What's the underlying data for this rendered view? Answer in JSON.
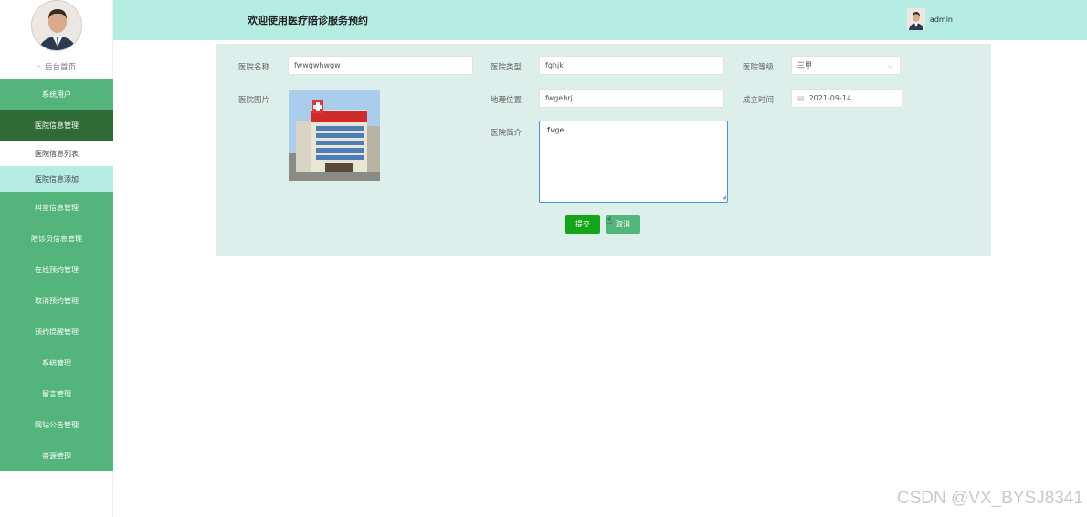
{
  "sidebar": {
    "home_label": "后台首页",
    "menu": [
      {
        "label": "系统用户",
        "active": false
      },
      {
        "label": "医院信息管理",
        "active": true
      }
    ],
    "sub_items": [
      {
        "label": "医院信息列表",
        "active": false
      },
      {
        "label": "医院信息添加",
        "active": true
      }
    ],
    "menu_after": [
      {
        "label": "科室信息管理"
      },
      {
        "label": "陪诊员信息管理"
      },
      {
        "label": "在线预约管理"
      },
      {
        "label": "取消预约管理"
      },
      {
        "label": "预约提醒管理"
      },
      {
        "label": "系统管理"
      },
      {
        "label": "留言管理"
      },
      {
        "label": "网站公告管理"
      },
      {
        "label": "资源管理"
      }
    ]
  },
  "header": {
    "title": "欢迎使用医疗陪诊服务预约",
    "username": "admin"
  },
  "form": {
    "hospital_name": {
      "label": "医院名称",
      "value": "fwwgwhwgw"
    },
    "hospital_type": {
      "label": "医院类型",
      "value": "fghjk"
    },
    "hospital_level": {
      "label": "医院等级",
      "value": "三甲"
    },
    "hospital_image": {
      "label": "医院图片"
    },
    "location": {
      "label": "地理位置",
      "value": "fwgehrj"
    },
    "founded": {
      "label": "成立时间",
      "value": "2021-09-14"
    },
    "intro": {
      "label": "医院简介",
      "value": "fwge"
    },
    "submit_label": "提交",
    "cancel_label": "取消"
  },
  "watermark": "CSDN @VX_BYSJ8341",
  "colors": {
    "sidebar_green": "#53b57c",
    "sidebar_active": "#2f6b36",
    "header_bg": "#b5ede2",
    "panel_bg": "#dcefeb",
    "submit_green": "#14a51b"
  }
}
